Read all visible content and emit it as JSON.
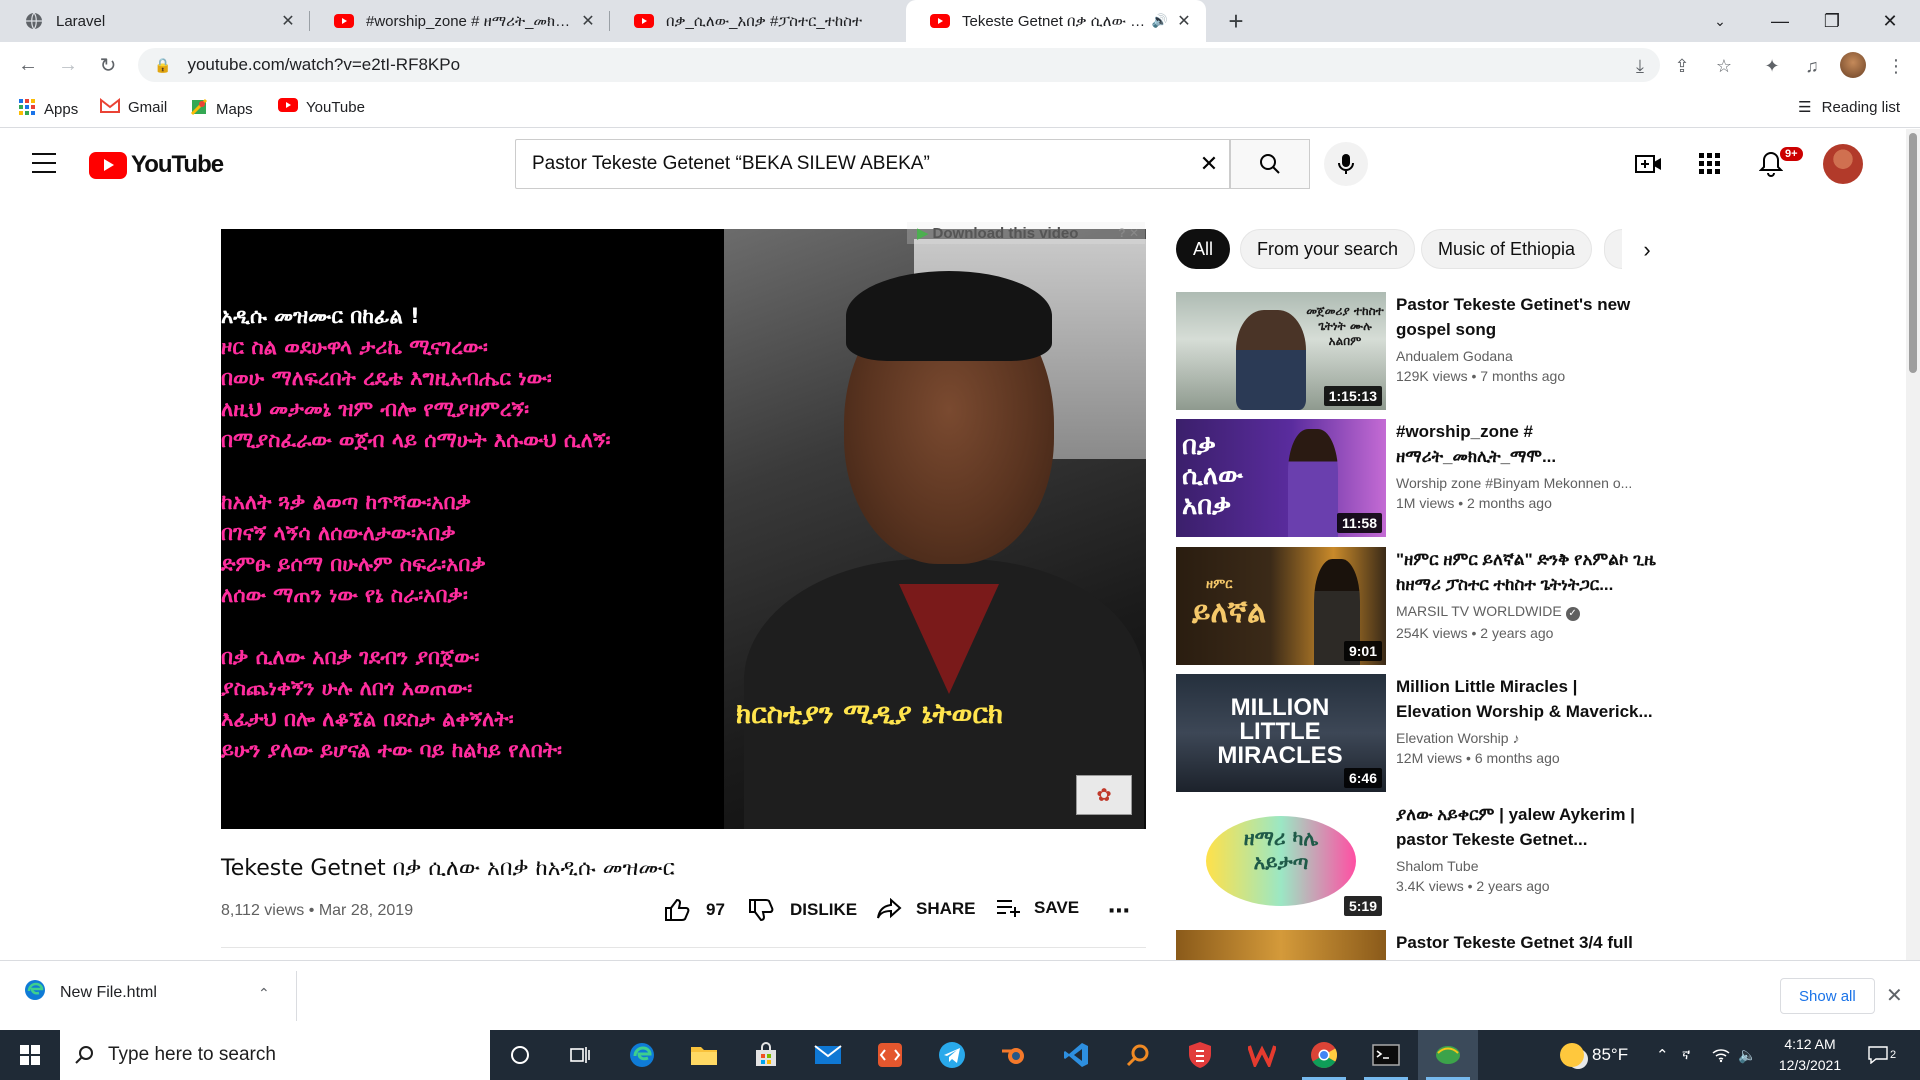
{
  "browser": {
    "tabs": [
      {
        "title": "Laravel",
        "favicon": "globe-icon",
        "active": false
      },
      {
        "title": "#worship_zone # ዘማሪት_መክሊት_ማሞ",
        "favicon": "youtube-icon",
        "active": false
      },
      {
        "title": "በቃ_ሲለው_አበቃ #ፓስተር_ተከስተ",
        "favicon": "youtube-icon",
        "active": false
      },
      {
        "title": "Tekeste Getnet በቃ ሲለው አበቃ",
        "favicon": "youtube-icon",
        "active": true
      }
    ],
    "url": "youtube.com/watch?v=e2tI-RF8KPo",
    "bookmarks": [
      {
        "label": "Apps",
        "icon": "apps-grid-icon"
      },
      {
        "label": "Gmail",
        "icon": "gmail-icon"
      },
      {
        "label": "Maps",
        "icon": "maps-icon"
      },
      {
        "label": "YouTube",
        "icon": "youtube-icon"
      }
    ],
    "reading_list": "Reading list"
  },
  "youtube": {
    "logo_text": "YouTube",
    "search_query": "Pastor Tekeste Getenet “BEKA SILEW ABEKA”",
    "notification_count": "9+"
  },
  "player": {
    "download_banner": "Download this video",
    "lyrics_first": "አዲሱ መዝሙር በከፊል !",
    "lyrics_block1": [
      "ዞር ስል ወደሁዋላ ታሪኬ ሚናገረው፡",
      "በወሁ ማለፍረበት ረዴቴ እግዚአብሔር ነው፡",
      "ለዚህ መታመኔ ዝም ብሎ የሚያዘምረኝ፡",
      "በሚያስፈራው ወጀብ ላይ ሰማሁት እሱውህ ሲለኝ፡"
    ],
    "lyrics_block2": [
      "ከአለት ጓቃ ልወጣ ከጥሻው፡አበቃ",
      "በገናኝ ላኝሳ ለሰውለታው፡አበቃ",
      "ድምፁ ይሰማ በሁሉም ስፍራ፡አበቃ",
      "ለሰው ማጠን ነው የኔ ስራ፡አበቃ፡"
    ],
    "lyrics_block3": [
      "በቃ ሲለው አበቃ ገደብን ያበጀው፡",
      "ያስጨነቀኝን ሁሉ ለበጎ አወጠው፡",
      "እፊታህ በሎ ለቆኜል በደስታ ልቀኝለት፡",
      "ይሁን ያለው ይሆናል ተው ባይ ከልካይ የለበት፡"
    ],
    "caption": "ክርስቲያን ሚዲያ ኔትወርክ"
  },
  "video": {
    "title": "Tekeste Getnet በቃ ሲለው አበቃ ከአዲሱ መዝሙር",
    "views": "8,112 views",
    "date": "Mar 28, 2019",
    "likes": "97",
    "dislike_label": "DISLIKE",
    "share_label": "SHARE",
    "save_label": "SAVE"
  },
  "chips": [
    "All",
    "From your search",
    "Music of Ethiopia"
  ],
  "recommendations": [
    {
      "title": "Pastor Tekeste Getinet's new gospel song",
      "channel": "Andualem Godana",
      "views": "129K views",
      "age": "7 months ago",
      "duration": "1:15:13",
      "thumb_text": "መጀመሪያ ተከስተ ጌትነት ሙሉ አልበም"
    },
    {
      "title": "#worship_zone # ዘማሪት_መክሊት_ማሞ...",
      "channel": "Worship zone #Binyam Mekonnen o...",
      "views": "1M views",
      "age": "2 months ago",
      "duration": "11:58",
      "thumb_text": "በቃ ሲለው አበቃ"
    },
    {
      "title": "\"ዘምር ዘምር ይለኛል\" ድንቅ የአምልኮ ጊዜ ከዘማሪ ፓስተር ተከስተ ጌትነትጋር...",
      "channel": "MARSIL TV WORLDWIDE",
      "views": "254K views",
      "age": "2 years ago",
      "duration": "9:01",
      "thumb_text": "ይለኛል",
      "thumb_small": "ዘምር"
    },
    {
      "title": "Million Little Miracles | Elevation Worship & Maverick...",
      "channel": "Elevation Worship",
      "views": "12M views",
      "age": "6 months ago",
      "duration": "6:46",
      "thumb_text": "MILLION LITTLE MIRACLES"
    },
    {
      "title": "ያለው አይቀርም | yalew Aykerim | pastor Tekeste Getnet...",
      "channel": "Shalom Tube",
      "views": "3.4K views",
      "age": "2 years ago",
      "duration": "5:19",
      "thumb_text": "ዘማሪ ካሌ አይታጣ"
    },
    {
      "title": "Pastor Tekeste Getnet 3/4 full",
      "channel": "",
      "views": "",
      "age": "",
      "duration": "",
      "thumb_text": ""
    }
  ],
  "downloads": {
    "file": "New File.html",
    "show_all": "Show all"
  },
  "taskbar": {
    "search_placeholder": "Type here to search",
    "weather": "85°F",
    "time": "4:12 AM",
    "date": "12/3/2021",
    "notifications": "2"
  },
  "colors": {
    "youtube_red": "#ff0000",
    "lyrics_pink": "#ff2d9e",
    "caption_yellow": "#ffe44d",
    "link_blue": "#1a73e8",
    "taskbar": "#1f2a36"
  }
}
